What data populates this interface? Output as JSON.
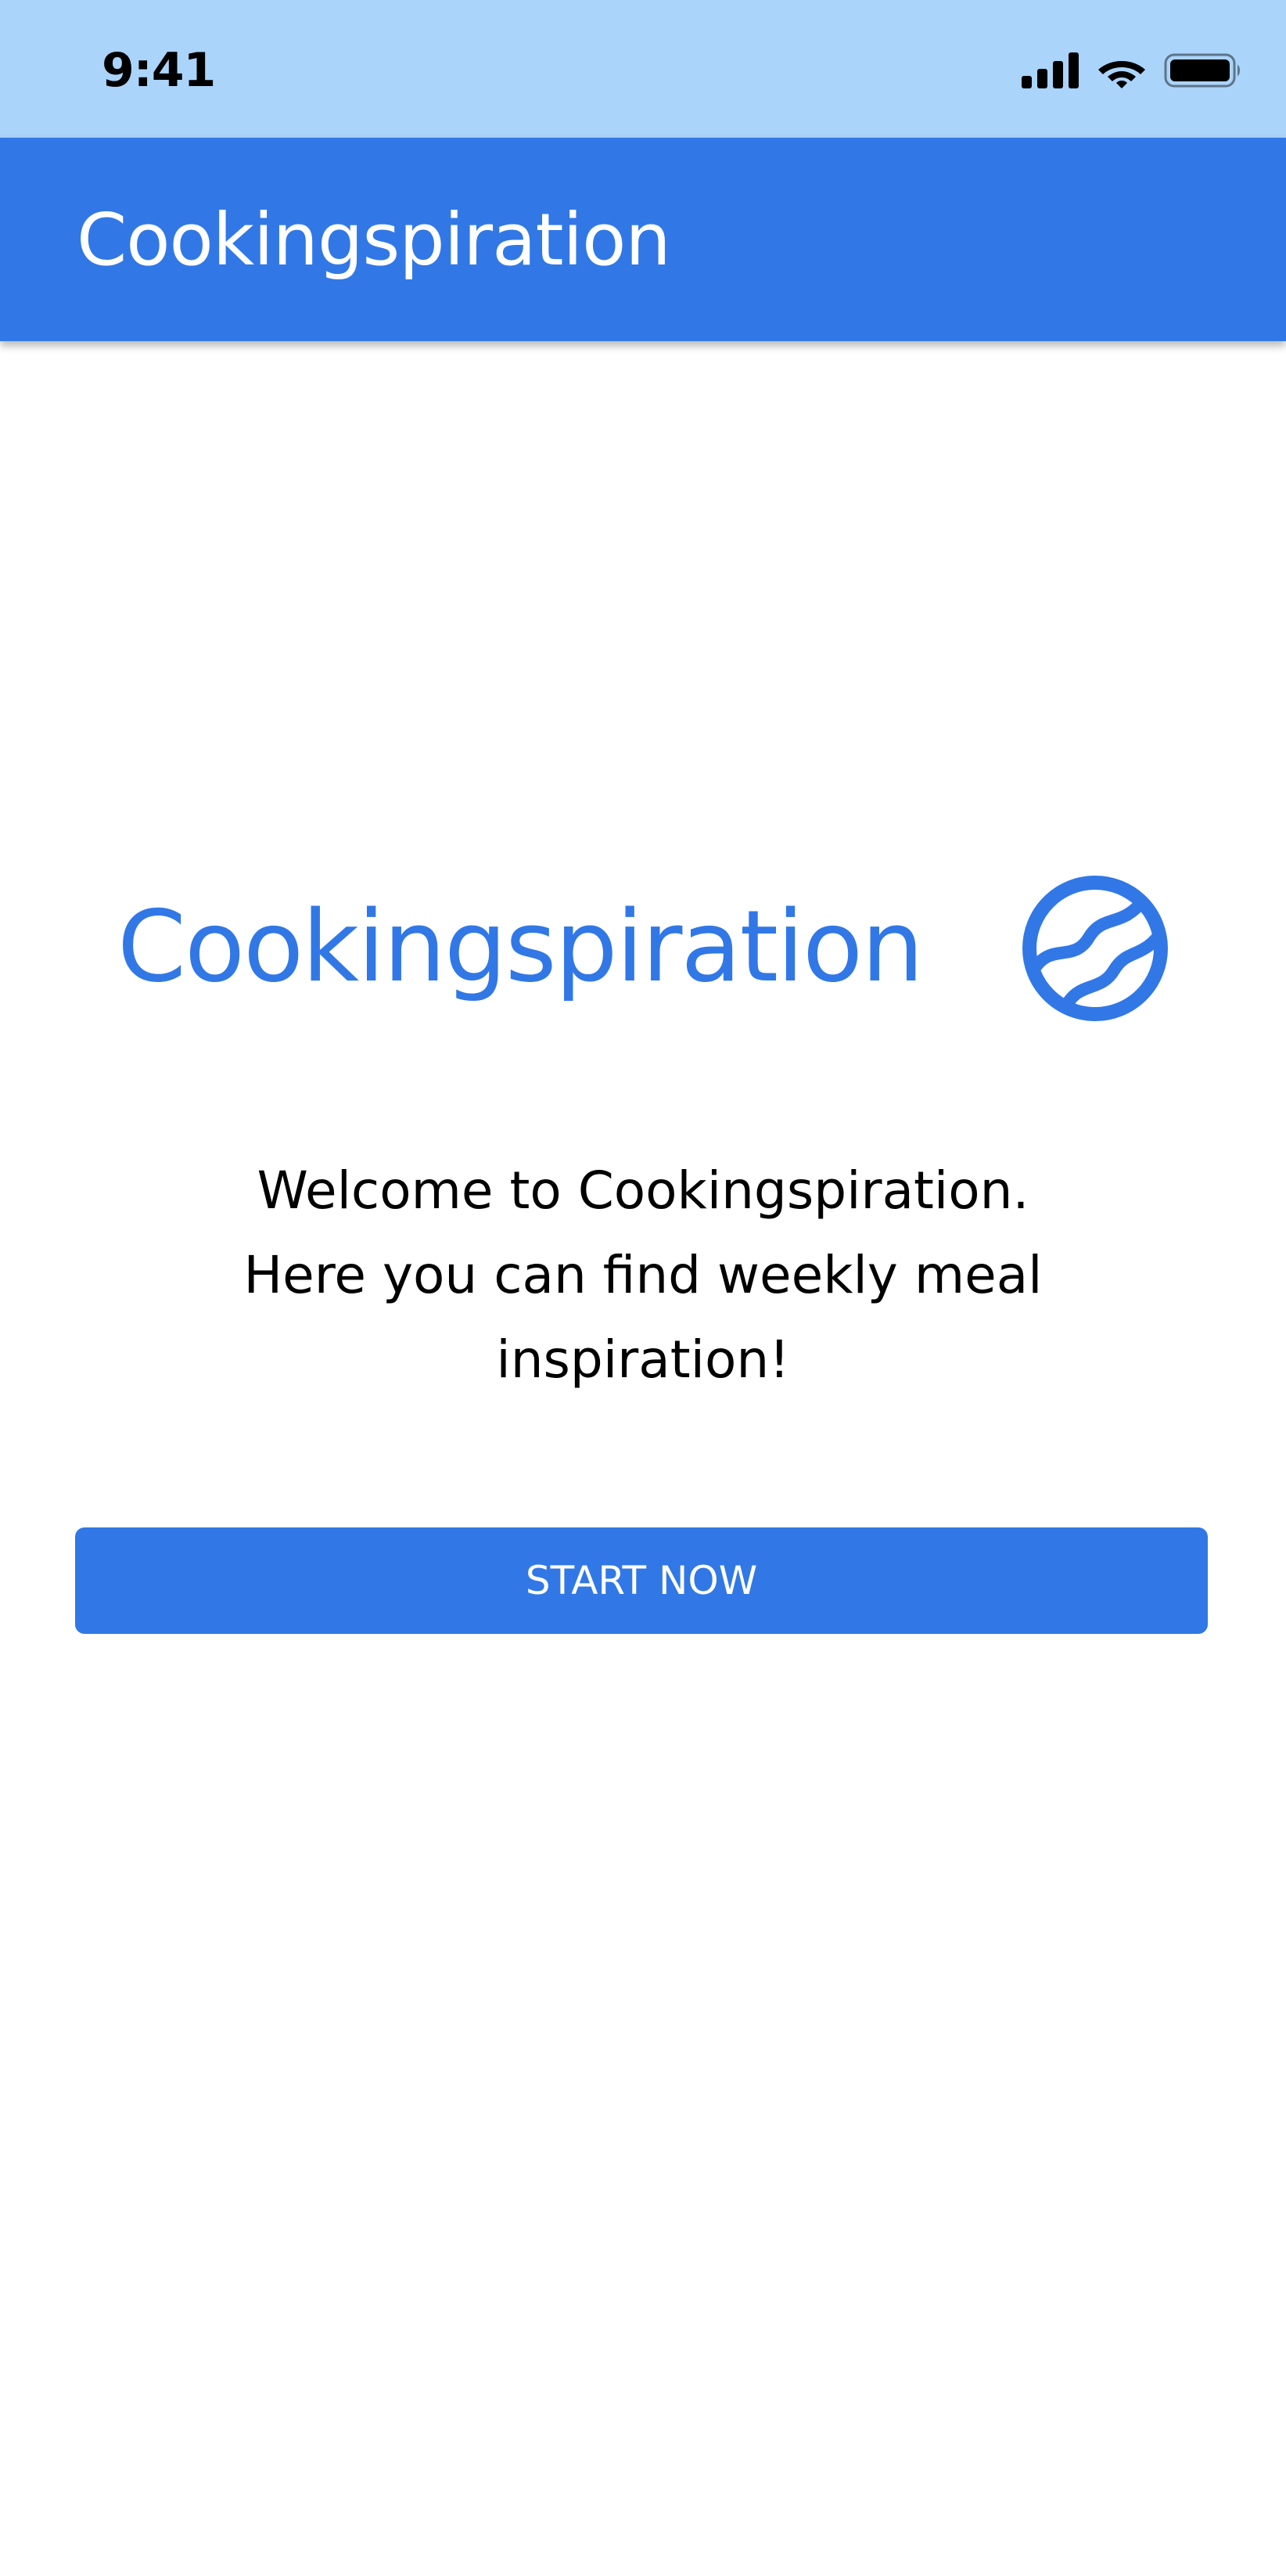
{
  "status_bar": {
    "time": "9:41",
    "icons": [
      "signal-icon",
      "wifi-icon",
      "battery-icon"
    ]
  },
  "app_bar": {
    "title": "Cookingspiration"
  },
  "logo": {
    "text": "Cookingspiration",
    "icon": "logo-circle-waves-icon"
  },
  "welcome": {
    "line1": "Welcome to Cookingspiration.",
    "line2": "Here you can find weekly meal",
    "line3": "inspiration!"
  },
  "button": {
    "label": "START NOW"
  },
  "colors": {
    "primary": "#3178e6",
    "status_bar_bg": "#abd4fa",
    "background": "#ffffff",
    "text": "#000000"
  }
}
